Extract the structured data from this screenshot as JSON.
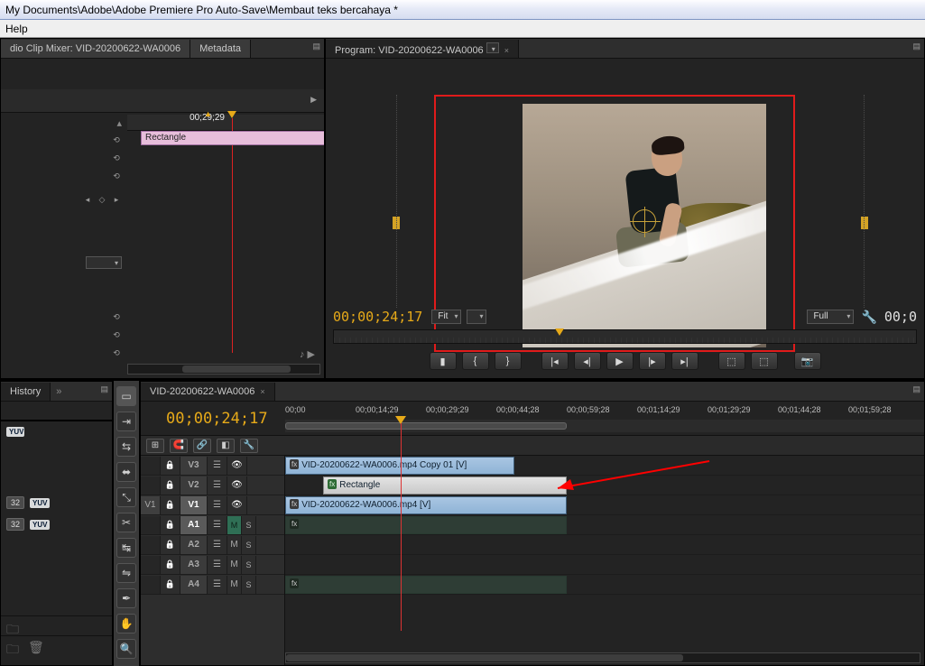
{
  "window": {
    "title": "My Documents\\Adobe\\Adobe Premiere Pro Auto-Save\\Membaut teks bercahaya *"
  },
  "menu": {
    "help": "Help"
  },
  "sourcePanel": {
    "tab1": "dio Clip Mixer: VID-20200622-WA0006",
    "tab2": "Metadata",
    "endTc": "00;29;29",
    "clipName": "Rectangle"
  },
  "program": {
    "tabLabel": "Program: VID-20200622-WA0006",
    "tc": "00;00;24;17",
    "fit": "Fit",
    "quality": "Full",
    "durationRight": "00;0"
  },
  "historyTab": "History",
  "fxBadges": {
    "n1": "32",
    "n2": "32",
    "yuv": "YUV"
  },
  "timeline": {
    "sequenceTab": "VID-20200622-WA0006",
    "tc": "00;00;24;17",
    "rulerLabels": [
      "00;00",
      "00;00;14;29",
      "00;00;29;29",
      "00;00;44;28",
      "00;00;59;28",
      "00;01;14;29",
      "00;01;29;29",
      "00;01;44;28",
      "00;01;59;28"
    ],
    "tracks": {
      "v3": "V3",
      "v2": "V2",
      "v1": "V1",
      "v1src": "V1",
      "a1": "A1",
      "a2": "A2",
      "a3": "A3",
      "a4": "A4",
      "m": "M",
      "s": "S"
    },
    "clips": {
      "v3": "VID-20200622-WA0006.mp4 Copy 01 [V]",
      "v2": "Rectangle",
      "v1": "VID-20200622-WA0006.mp4 [V]",
      "fx": "fx"
    }
  }
}
